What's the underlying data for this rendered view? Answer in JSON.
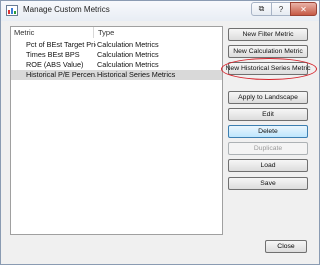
{
  "window": {
    "title": "Manage Custom Metrics",
    "titlebar_buttons": {
      "filter": "⧉",
      "help": "?",
      "close": "✕"
    }
  },
  "list": {
    "columns": [
      "Metric",
      "Type"
    ],
    "rows": [
      {
        "metric": "Pct of BEst Target Price",
        "type": "Calculation Metrics",
        "selected": false
      },
      {
        "metric": "Times BEst BPS",
        "type": "Calculation Metrics",
        "selected": false
      },
      {
        "metric": "ROE (ABS Value)",
        "type": "Calculation Metrics",
        "selected": false
      },
      {
        "metric": "Historical P/E Percen...",
        "type": "Historical Series Metrics",
        "selected": true
      }
    ]
  },
  "buttons": {
    "new_filter": "New Filter Metric",
    "new_calc": "New Calculation Metric",
    "new_hist": "New Historical Series Metric",
    "apply": "Apply to Landscape",
    "edit": "Edit",
    "delete": "Delete",
    "duplicate": "Duplicate",
    "load": "Load",
    "save": "Save",
    "close": "Close"
  },
  "colors": {
    "highlight_ring": "#d6232b",
    "selection": "#d9d9d9",
    "focus_button": "#bee6fd"
  }
}
